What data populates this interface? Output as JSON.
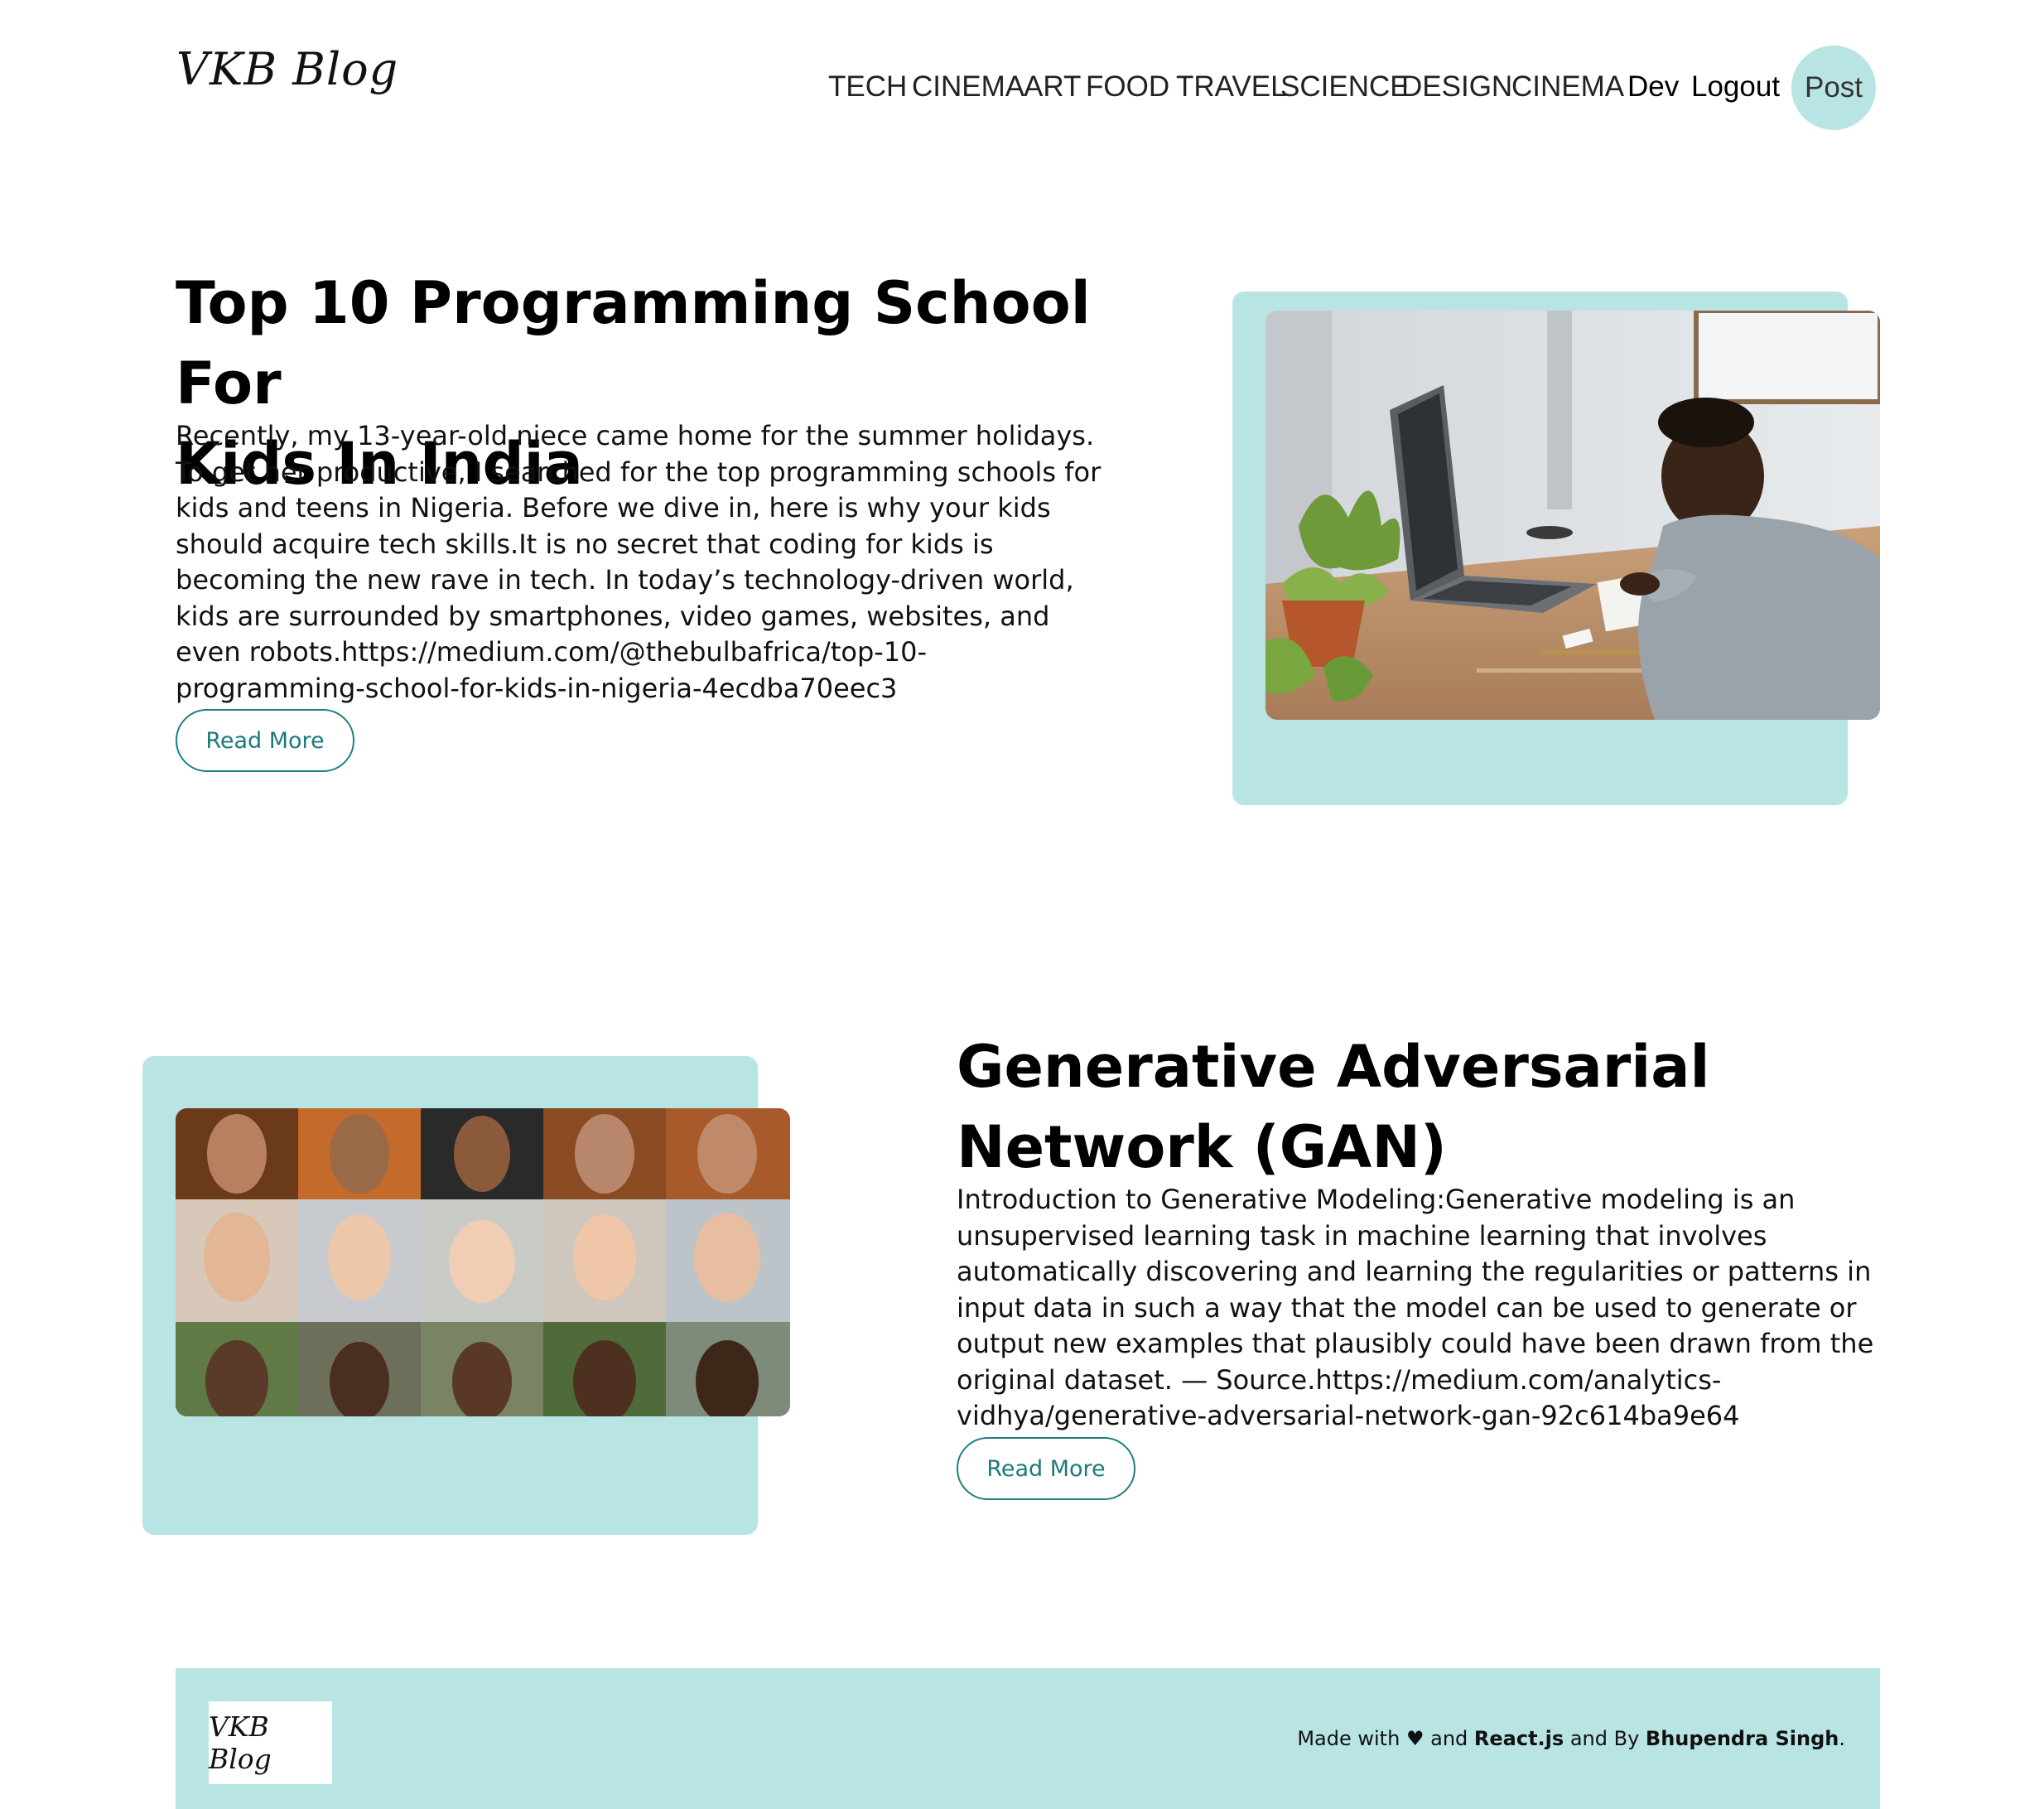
{
  "header": {
    "logo": "VKB Blog",
    "nav": [
      "TECH",
      "CINEMA",
      "ART",
      "FOOD",
      "TRAVEL",
      "SCIENCE",
      "DESIGN",
      "CINEMA"
    ],
    "dev": "Dev",
    "logout": "Logout",
    "post": "Post"
  },
  "posts": [
    {
      "title_line1": "Top 10 Programming School For",
      "title_line2": "Kids In India",
      "body": "Recently, my 13-year-old niece came home for the summer holidays. To get her productive, I searched for the top programming schools for kids and teens in Nigeria. Before we dive in, here is why your kids should acquire tech skills.It is no secret that coding for kids is becoming the new rave in tech. In today’s technology-driven world, kids are surrounded by smartphones, video games, websites, and even robots.https://medium.com/@thebulbafrica/top-10-programming-school-for-kids-in-nigeria-4ecdba70eec3",
      "read_more": "Read More"
    },
    {
      "title_line1": "Generative Adversarial",
      "title_line2": "Network (GAN)",
      "body": "Introduction to Generative Modeling:Generative modeling is an unsupervised learning task in machine learning that involves automatically discovering and learning the regularities or patterns in input data in such a way that the model can be used to generate or output new examples that plausibly could have been drawn from the original dataset. — Source.https://medium.com/analytics-vidhya/generative-adversarial-network-gan-92c614ba9e64",
      "read_more": "Read More"
    }
  ],
  "footer": {
    "logo": "VKB Blog",
    "made_with": "Made with",
    "heart": "♥",
    "and1": "and",
    "react": "React.js",
    "and_by": "and By",
    "author": "Bhupendra Singh",
    "period": "."
  },
  "colors": {
    "accent": "#b8e5e4",
    "button_border": "#1e8080"
  }
}
